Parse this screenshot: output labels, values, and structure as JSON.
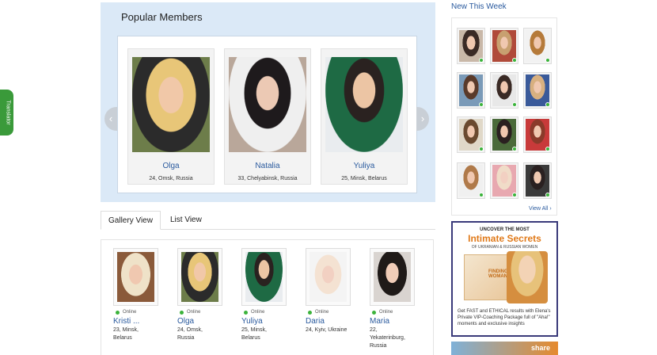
{
  "translator": {
    "label": "Translator"
  },
  "popular": {
    "title": "Popular Members",
    "members": [
      {
        "name": "Olga",
        "info": "24, Omsk, Russia"
      },
      {
        "name": "Natalia",
        "info": "33, Chelyabinsk, Russia"
      },
      {
        "name": "Yuliya",
        "info": "25, Minsk, Belarus"
      }
    ]
  },
  "tabs": {
    "gallery": "Gallery View",
    "list": "List View"
  },
  "gallery": {
    "online_label": "Online",
    "items": [
      {
        "name": "Kristi ...",
        "line1": "23, Minsk,",
        "line2": "Belarus",
        "line3": ""
      },
      {
        "name": "Olga",
        "line1": "24, Omsk,",
        "line2": "Russia",
        "line3": ""
      },
      {
        "name": "Yuliya",
        "line1": "25, Minsk,",
        "line2": "Belarus",
        "line3": ""
      },
      {
        "name": "Daria",
        "line1": "24, Kyiv, Ukraine",
        "line2": "",
        "line3": ""
      },
      {
        "name": "Maria",
        "line1": "22,",
        "line2": "Yekaterinburg,",
        "line3": "Russia"
      }
    ]
  },
  "new_this_week": {
    "title": "New This Week",
    "view_all": "View All ›"
  },
  "ad": {
    "line1": "UNCOVER THE MOST",
    "line2": "Intimate Secrets",
    "line3": "OF UKRANIAN & RUSSIAN WOMEN",
    "book_text": "FINDING WOMAN",
    "body": "Get FAST and ETHICAL results with Elena's Private VIP-Coaching Package full of \"Aha!\" moments and exclusive insights"
  },
  "share": {
    "label": "share"
  },
  "colors": {
    "link": "#2a5a9e",
    "panel": "#dbe9f7",
    "online": "#3bb33b",
    "translator": "#3a9a3a"
  }
}
